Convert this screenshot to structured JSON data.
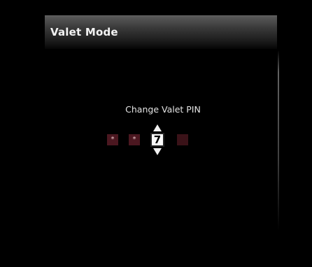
{
  "header": {
    "title": "Valet Mode"
  },
  "pin": {
    "label": "Change Valet PIN",
    "digits": [
      "*",
      "*",
      "7",
      ""
    ],
    "active_index": 2
  },
  "colors": {
    "background": "#000000",
    "pin_box": "#4b1720",
    "active_box": "#fafafa"
  },
  "icons": {
    "increment": "arrow-up-icon",
    "decrement": "arrow-down-icon"
  }
}
